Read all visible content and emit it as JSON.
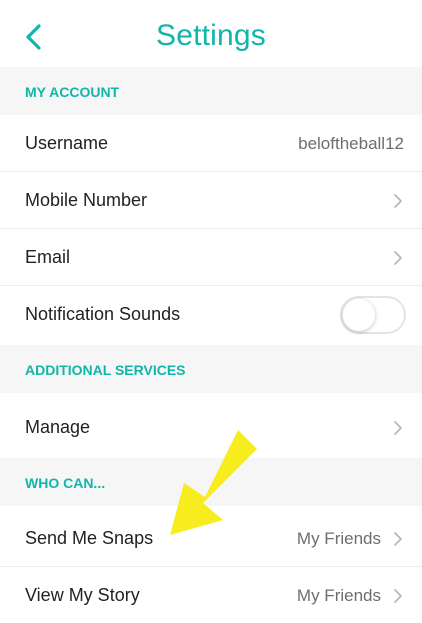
{
  "header": {
    "title": "Settings",
    "back_icon": "chevron-left-icon"
  },
  "sections": {
    "my_account": "MY ACCOUNT",
    "additional_services": "ADDITIONAL SERVICES",
    "who_can": "WHO CAN..."
  },
  "rows": {
    "username": {
      "label": "Username",
      "value": "beloftheball12"
    },
    "mobile": {
      "label": "Mobile Number"
    },
    "email": {
      "label": "Email"
    },
    "notification_sounds": {
      "label": "Notification Sounds",
      "toggle_on": false
    },
    "manage": {
      "label": "Manage"
    },
    "send_snaps": {
      "label": "Send Me Snaps",
      "value": "My Friends"
    },
    "view_story": {
      "label": "View My Story",
      "value": "My Friends"
    }
  },
  "annotation": {
    "arrow_color": "#f7ec1d"
  },
  "colors": {
    "accent": "#0fb6a9",
    "section_bg": "#f6f6f6"
  }
}
